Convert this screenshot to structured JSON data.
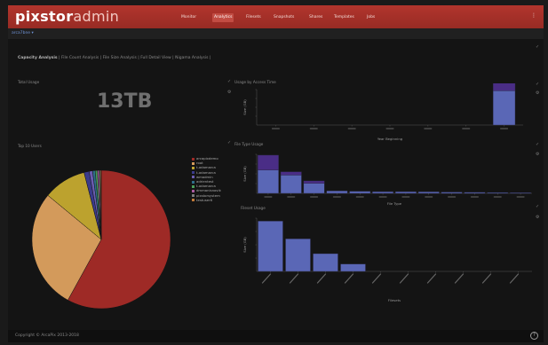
{
  "app": {
    "logo_bold": "pixstor",
    "logo_light": "admin"
  },
  "nav": [
    "Monitor",
    "Analytics",
    "Filesets",
    "Snapshots",
    "Shares",
    "Templates",
    "Jobs"
  ],
  "nav_active": 1,
  "topbar": {
    "menu_icon": "vertical-dots-icon"
  },
  "user": {
    "label": "arca7bne ▾"
  },
  "tabs": [
    "Capacity Analysis",
    "File Count Analysis",
    "File Size Analysis",
    "Full Detail View",
    "Nigama Analysis"
  ],
  "tabs_active": 0,
  "panels": {
    "total_usage": {
      "title": "Total Usage",
      "value": "13TB"
    },
    "top_users": {
      "title": "Top 10 Users"
    },
    "access_time": {
      "title": "Usage by Access Time",
      "xlabel": "Year Beginning",
      "ylabel": "Size (GB)"
    },
    "file_type": {
      "title": "File Type Usage",
      "xlabel": "File Type",
      "ylabel": "Size (GB)"
    },
    "fileset": {
      "title": "Fileset Usage",
      "xlabel": "Filesets",
      "ylabel": "Size (GB)"
    }
  },
  "legend": [
    "arcapixdemo",
    "root",
    "t-adamarca",
    "t-adamarca",
    "wmadmin",
    "adrientest",
    "t-adamarca",
    "dmmanisnovik",
    "pixstorsystem",
    "testuser6"
  ],
  "footer": {
    "copyright": "Copyright © ArcaPix 2013-2018",
    "help_icon": "help-icon"
  },
  "colors": {
    "topbar": "#a9322b",
    "bar_blue": "#5a67b6",
    "bar_purple": "#4a2d86",
    "pie": [
      "#9e2a26",
      "#d39a5b",
      "#bca22e",
      "#3a3a8a",
      "#6a5cb0",
      "#2e6d8a",
      "#4a9e5a",
      "#aa5aa0",
      "#7a7a7a",
      "#c07a3a"
    ]
  },
  "chart_data": [
    {
      "type": "pie",
      "title": "Top 10 Users",
      "categories": [
        "arcapixdemo",
        "root",
        "t-adamarca",
        "t-adamarca",
        "wmadmin",
        "adrientest",
        "t-adamarca",
        "dmmanisnovik",
        "pixstorsystem",
        "testuser6"
      ],
      "values": [
        58.0,
        28.0,
        10.0,
        1.2,
        0.8,
        0.6,
        0.5,
        0.4,
        0.3,
        0.2
      ]
    },
    {
      "type": "bar",
      "title": "Usage by Access Time",
      "categories": [
        "2012",
        "2013",
        "2014",
        "2015",
        "2016",
        "2017",
        "2018"
      ],
      "series": [
        {
          "values": [
            0,
            0,
            0,
            0,
            0,
            0,
            2.9
          ]
        },
        {
          "values": [
            0,
            0,
            0,
            0,
            0,
            0,
            1.0
          ]
        }
      ],
      "xlabel": "Year Beginning",
      "ylabel": "Size (GB)"
    },
    {
      "type": "bar",
      "title": "File Type Usage",
      "categories": [
        "t1",
        "t2",
        "t3",
        "t4",
        "t5",
        "t6",
        "t7",
        "t8",
        "t9",
        "t10",
        "t11",
        "t12"
      ],
      "series": [
        {
          "values": [
            2.8,
            2.2,
            1.2,
            0.3,
            0.25,
            0.2,
            0.2,
            0.18,
            0.15,
            0.12,
            0.1,
            0.08
          ]
        },
        {
          "values": [
            1.8,
            0.4,
            0.3,
            0,
            0,
            0,
            0,
            0,
            0,
            0,
            0,
            0
          ]
        }
      ],
      "xlabel": "File Type",
      "ylabel": "Size (GB)"
    },
    {
      "type": "bar",
      "title": "Fileset Usage",
      "categories": [
        "f1",
        "f2",
        "f3",
        "f4",
        "f5",
        "f6",
        "f7",
        "f8",
        "f9",
        "f10"
      ],
      "values": [
        3.4,
        2.2,
        1.2,
        0.5,
        0,
        0,
        0,
        0,
        0,
        0
      ],
      "xlabel": "Filesets",
      "ylabel": "Size (GB)"
    }
  ]
}
